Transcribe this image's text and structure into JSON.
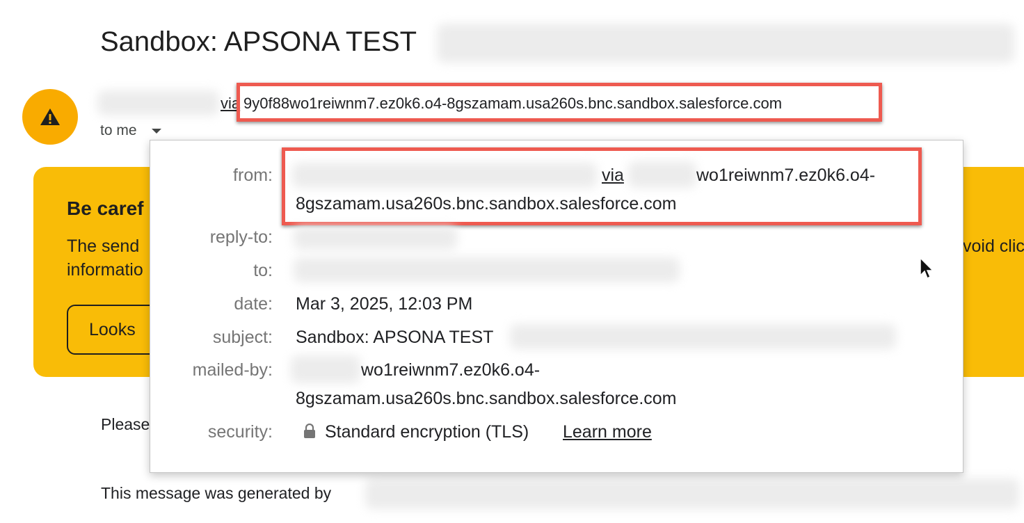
{
  "email": {
    "subject": "Sandbox: APSONA TEST",
    "sender": {
      "via_label": "via",
      "address": "9y0f88wo1reiwnm7.ez0k6.o4-8gszamam.usa260s.bnc.sandbox.salesforce.com"
    },
    "recipient_toggle": "to me",
    "avatar_icon": "warning-icon",
    "avatar_color": "#f9ab00"
  },
  "warning_banner": {
    "title": "Be caref",
    "line1": "The send",
    "line1_tail": "void clic",
    "line2": "informatio",
    "button_label": "Looks",
    "color": "#f9bc07"
  },
  "details": {
    "from": {
      "label": "from:",
      "via": "via",
      "line1_tail": "wo1reiwnm7.ez0k6.o4-",
      "line2": "8gszamam.usa260s.bnc.sandbox.salesforce.com"
    },
    "reply_to": {
      "label": "reply-to:"
    },
    "to": {
      "label": "to:"
    },
    "date": {
      "label": "date:",
      "value": "Mar 3, 2025, 12:03 PM"
    },
    "subject": {
      "label": "subject:",
      "value": "Sandbox: APSONA TEST"
    },
    "mailed_by": {
      "label": "mailed-by:",
      "line1_tail": "wo1reiwnm7.ez0k6.o4-",
      "line2": "8gszamam.usa260s.bnc.sandbox.salesforce.com"
    },
    "security": {
      "label": "security:",
      "value": "Standard encryption (TLS)",
      "link": "Learn more",
      "icon": "lock-icon"
    }
  },
  "body": {
    "line1": "Please",
    "line2": "This message was generated by"
  },
  "highlight_color": "#ee5a50"
}
